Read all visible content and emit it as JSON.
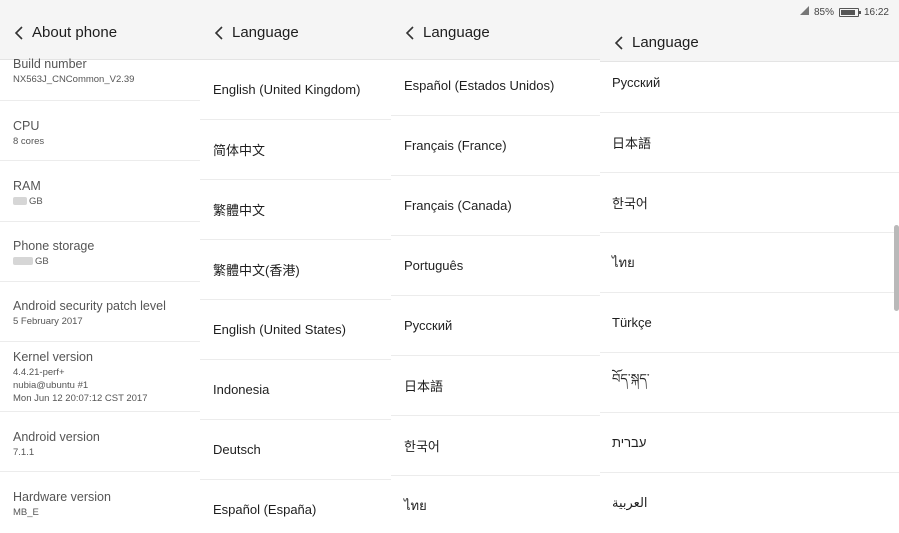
{
  "status_bar": {
    "battery_percent": "85%",
    "battery_level": 0.85,
    "time": "16:22"
  },
  "about": {
    "title": "About phone",
    "rows": [
      {
        "label": "Build number",
        "values": [
          "NX563J_CNCommon_V2.39"
        ]
      },
      {
        "label": "CPU",
        "values": [
          "8 cores"
        ]
      },
      {
        "label": "RAM",
        "values": [
          "GB"
        ],
        "redacted": true
      },
      {
        "label": "Phone storage",
        "values": [
          "GB"
        ],
        "redacted": true
      },
      {
        "label": "Android security patch level",
        "values": [
          "5 February 2017"
        ]
      },
      {
        "label": "Kernel version",
        "values": [
          "4.4.21-perf+",
          "nubia@ubuntu #1",
          "Mon Jun 12 20:07:12 CST 2017"
        ]
      },
      {
        "label": "Android version",
        "values": [
          "7.1.1"
        ]
      },
      {
        "label": "Hardware version",
        "values": [
          "MB_E"
        ]
      }
    ]
  },
  "lang1": {
    "title": "Language",
    "items": [
      "English (United Kingdom)",
      "简体中文",
      "繁體中文",
      "繁體中文(香港)",
      "English (United States)",
      "Indonesia",
      "Deutsch",
      "Español (España)"
    ]
  },
  "lang2": {
    "title": "Language",
    "items": [
      "Español (Estados Unidos)",
      "Français (France)",
      "Français (Canada)",
      "Português",
      "Русский",
      "日本語",
      "한국어",
      "ไทย"
    ]
  },
  "lang3": {
    "title": "Language",
    "items": [
      "Русский",
      "日本語",
      "한국어",
      "ไทย",
      "Türkçe",
      "བོད་སྐད་",
      "עברית",
      "العربية"
    ]
  }
}
